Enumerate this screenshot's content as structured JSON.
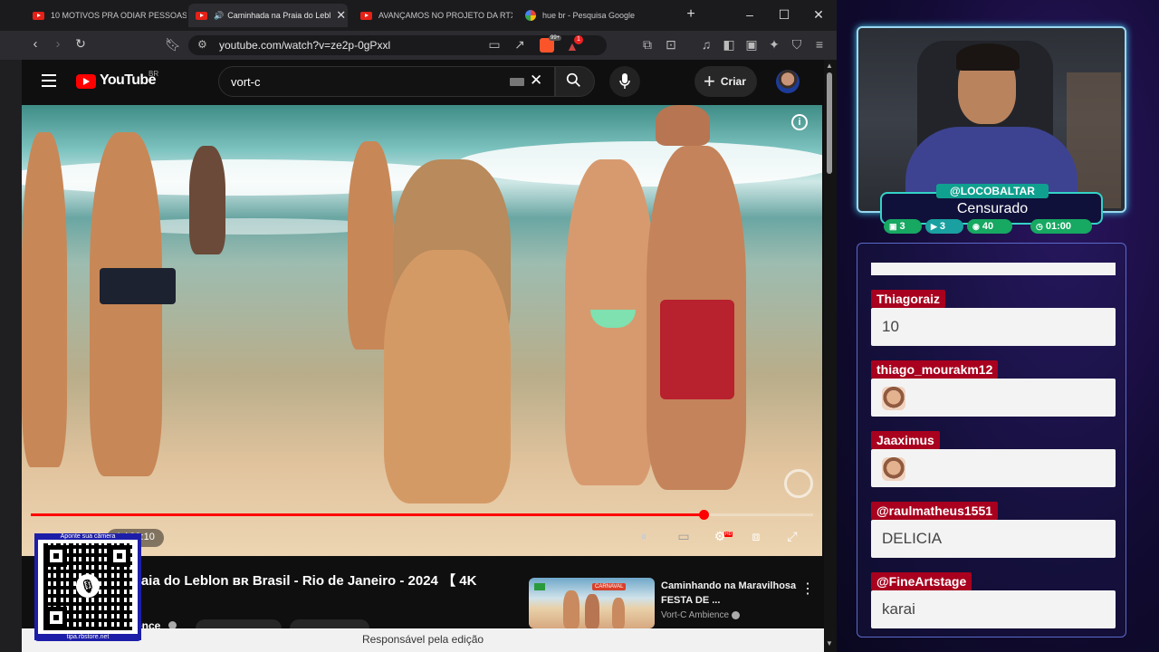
{
  "browser": {
    "tabs": [
      {
        "title": "10 MOTIVOS PRA ODIAR PESSOAS PC",
        "icon": "youtube-icon",
        "active": false
      },
      {
        "title": "Caminhada na Praia do Lebl",
        "icon": "youtube-icon",
        "active": true
      },
      {
        "title": "AVANÇAMOS NO PROJETO DA RTX 50",
        "icon": "youtube-icon",
        "active": false
      },
      {
        "title": "hue br - Pesquisa Google",
        "icon": "google-icon",
        "active": false
      }
    ],
    "url": "youtube.com/watch?v=ze2p-0gPxxl",
    "ext_badge": "99+",
    "ext_badge2": "1"
  },
  "youtube": {
    "logo_text": "YouTube",
    "region": "BR",
    "search_value": "vort-c",
    "create_label": "Criar",
    "video": {
      "time": "/ 23:10",
      "time_current": "1",
      "progress": 0.86,
      "title": "raia do Leblon ʙʀ Brasil - Rio de Janeiro - 2024 【 4K",
      "channel": "ence"
    },
    "recommended": {
      "title": "Caminhando na Maravilhosa FESTA DE ...",
      "channel": "Vort-C Ambience",
      "thumb_text": "CARNAVAL"
    },
    "footer": "Responsável pela edição"
  },
  "qr": {
    "header": "Aponte sua câmera",
    "footer": "tipa.rbstore.net"
  },
  "stream": {
    "username": "@LOCOBALTAR",
    "status": "Censurado",
    "stats": [
      {
        "icon": "chat-icon",
        "value": "3",
        "color": "#17a862"
      },
      {
        "icon": "video-icon",
        "value": "3",
        "color": "#1aa0a0"
      },
      {
        "icon": "emote-icon",
        "value": "40",
        "color": "#17a862"
      },
      {
        "icon": "clock-icon",
        "value": "01:00",
        "color": "#17a862"
      }
    ],
    "chat": [
      {
        "user": "Thiagoraiz",
        "message": "10",
        "emote": false
      },
      {
        "user": "thiago_mourakm12",
        "message": "",
        "emote": true
      },
      {
        "user": "Jaaximus",
        "message": "",
        "emote": true
      },
      {
        "user": "@raulmatheus1551",
        "message": "DELICIA",
        "emote": false
      },
      {
        "user": "@FineArtstage",
        "message": "karai",
        "emote": false
      }
    ]
  }
}
